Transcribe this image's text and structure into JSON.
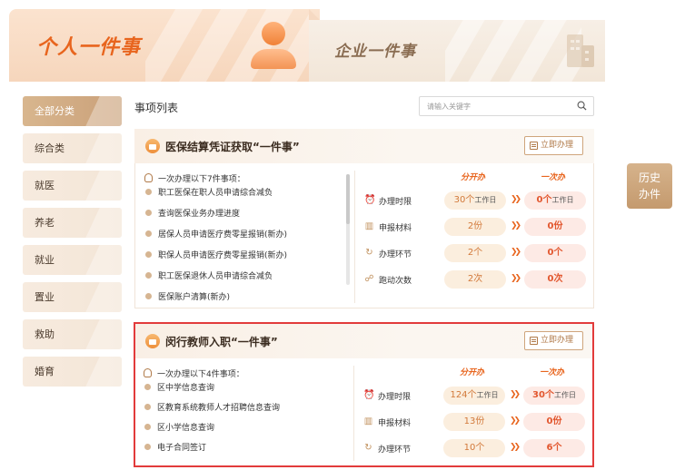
{
  "header": {
    "tab_personal": "个人一件事",
    "tab_company": "企业一件事"
  },
  "sidebar": {
    "items": [
      {
        "label": "全部分类",
        "active": true
      },
      {
        "label": "综合类"
      },
      {
        "label": "就医"
      },
      {
        "label": "养老"
      },
      {
        "label": "就业"
      },
      {
        "label": "置业"
      },
      {
        "label": "救助"
      },
      {
        "label": "婚育"
      }
    ]
  },
  "main": {
    "title": "事项列表",
    "search_placeholder": "请输入关键字"
  },
  "stats_headers": {
    "before": "分开办",
    "after": "一次办"
  },
  "cards": [
    {
      "title": "医保结算凭证获取“一件事”",
      "apply_label": "立即办理",
      "lead": "一次办理以下7件事项：",
      "items": [
        "职工医保在职人员申请综合减负",
        "查询医保业务办理进度",
        "居保人员申请医疗费零星报销(新办)",
        "职保人员申请医疗费零星报销(新办)",
        "职工医保退休人员申请综合减负",
        "医保账户清算(新办)"
      ],
      "stats": [
        {
          "label": "办理时限",
          "icon": "clock-icon",
          "before_num": "30个",
          "before_unit": "工作日",
          "after_num": "0个",
          "after_unit": "工作日"
        },
        {
          "label": "申报材料",
          "icon": "books-icon",
          "before_num": "2份",
          "before_unit": "",
          "after_num": "0份",
          "after_unit": ""
        },
        {
          "label": "办理环节",
          "icon": "cycle-icon",
          "before_num": "2个",
          "before_unit": "",
          "after_num": "0个",
          "after_unit": ""
        },
        {
          "label": "跑动次数",
          "icon": "running-icon",
          "before_num": "2次",
          "before_unit": "",
          "after_num": "0次",
          "after_unit": ""
        }
      ]
    },
    {
      "title": "闵行教师入职“一件事”",
      "apply_label": "立即办理",
      "lead": "一次办理以下4件事项：",
      "items": [
        "区中学信息查询",
        "区教育系统教师人才招聘信息查询",
        "区小学信息查询",
        "电子合同签订"
      ],
      "stats": [
        {
          "label": "办理时限",
          "icon": "clock-icon",
          "before_num": "124个",
          "before_unit": "工作日",
          "after_num": "30个",
          "after_unit": "工作日"
        },
        {
          "label": "申报材料",
          "icon": "books-icon",
          "before_num": "13份",
          "before_unit": "",
          "after_num": "0份",
          "after_unit": ""
        },
        {
          "label": "办理环节",
          "icon": "cycle-icon",
          "before_num": "10个",
          "before_unit": "",
          "after_num": "6个",
          "after_unit": ""
        }
      ]
    }
  ],
  "history_button": {
    "line1": "历史",
    "line2": "办件"
  },
  "colors": {
    "accent": "#e8651e",
    "gold": "#c49a6e",
    "highlight": "#e23b3b"
  }
}
